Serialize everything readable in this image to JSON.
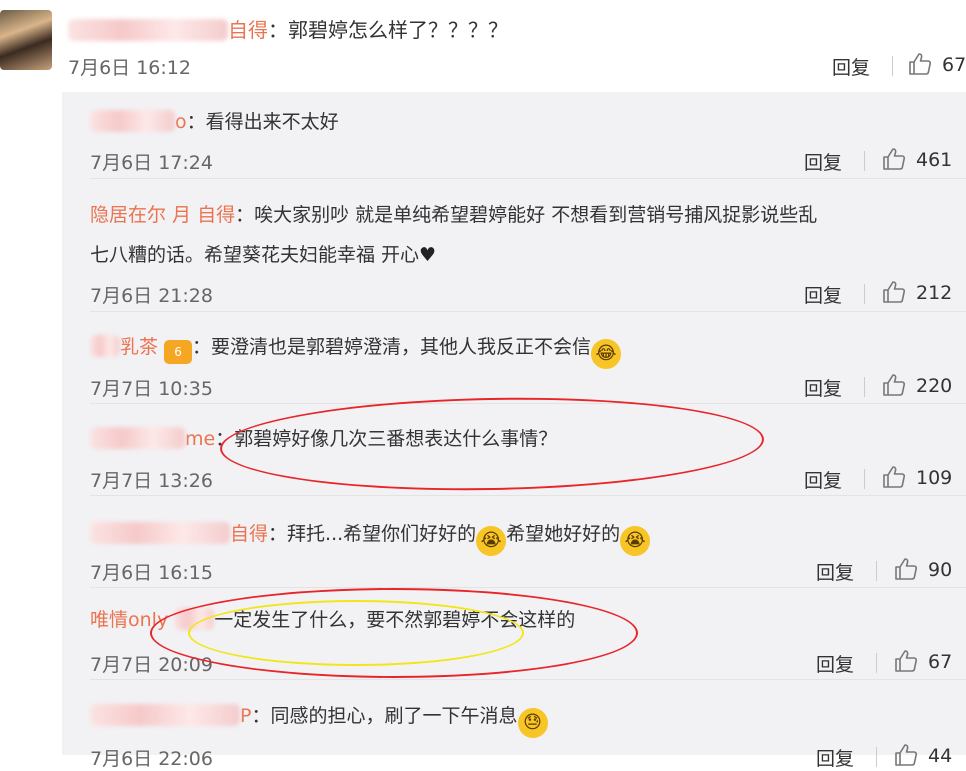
{
  "main": {
    "separator": "：",
    "name_suffix": "自得",
    "text": "郭碧婷怎么样了？？？？",
    "date": "7月6日 16:12",
    "reply": "回复",
    "likes": "67"
  },
  "subs": [
    {
      "name": "o",
      "text": "看得出来不太好",
      "date": "7月6日 17:24",
      "reply": "回复",
      "likes": "461"
    },
    {
      "name": "隐居在尔   月   自得",
      "text": "唉大家别吵 就是单纯希望碧婷能好 不想看到营销号捕风捉影说些乱",
      "text2": "七八糟的话。希望葵花夫妇能幸福 开心",
      "date": "7月6日 21:28",
      "reply": "回复",
      "likes": "212"
    },
    {
      "name": "乳茶",
      "vip": "6",
      "text": "要澄清也是郭碧婷澄清，其他人我反正不会信",
      "date": "7月7日 10:35",
      "reply": "回复",
      "likes": "220"
    },
    {
      "name": "me",
      "text": "郭碧婷好像几次三番想表达什么事情？",
      "date": "7月7日 13:26",
      "reply": "回复",
      "likes": "109"
    },
    {
      "name": "自得",
      "text": "拜托...希望你们好好的",
      "text2": "希望她好好的",
      "date": "7月6日 16:15",
      "reply": "回复",
      "likes": "90"
    },
    {
      "name": "唯情only",
      "text": "一定发生了什么，要不然郭碧婷不会这样的",
      "date": "7月7日 20:09",
      "reply": "回复",
      "likes": "67"
    },
    {
      "name": "P",
      "text": "同感的担心，刷了一下午消息",
      "date": "7月6日 22:06",
      "reply": "回复",
      "likes": "44"
    }
  ],
  "colors": {
    "name": "#eb7350",
    "highlight_red": "#e8262a",
    "highlight_yellow": "#f1e61a",
    "sub_bg": "#f2f2f5"
  },
  "icons": [
    "thumb-up-icon",
    "laugh-cry-emoji",
    "crying-emoji",
    "sweat-emoji",
    "heart-icon",
    "vip-badge-icon"
  ]
}
